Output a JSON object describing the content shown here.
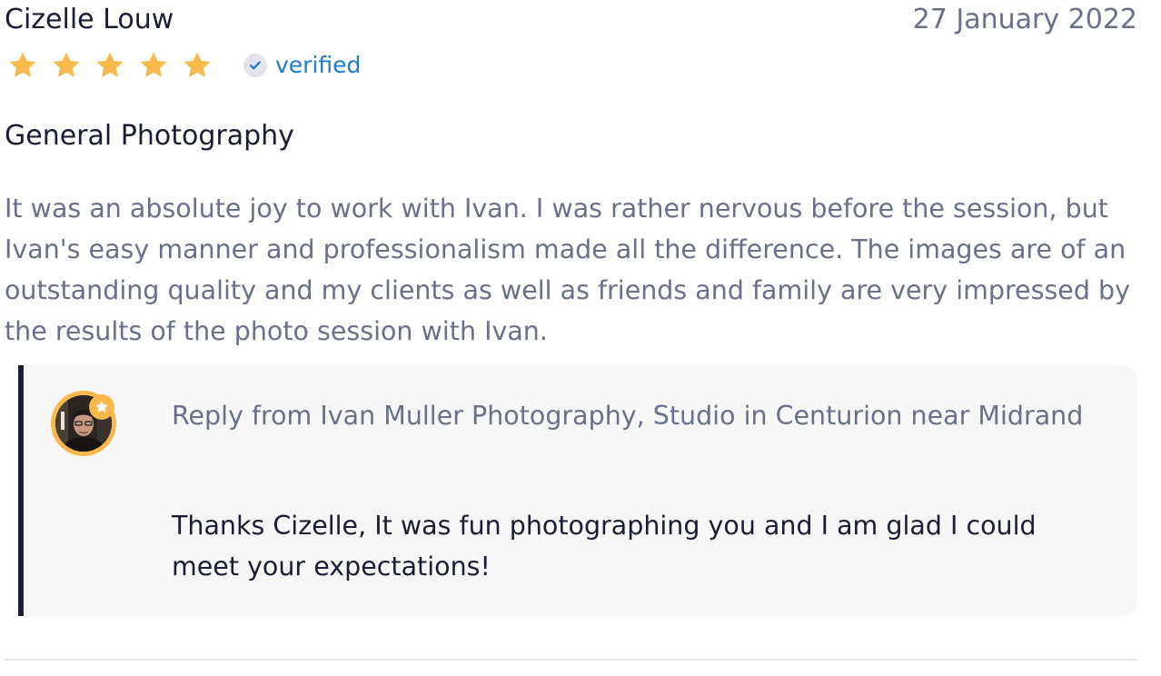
{
  "review": {
    "reviewer_name": "Cizelle Louw",
    "date": "27 January 2022",
    "rating": 5,
    "rating_max": 5,
    "star_color": "#F8B84C",
    "verified_label": "verified",
    "verified_color": "#1B7AD6",
    "title": "General Photography",
    "body": "It was an absolute joy to work with Ivan. I was rather nervous before the session, but Ivan's easy manner and professionalism made all the difference. The images are of an outstanding quality and my clients as well as friends and family are very impressed by the results of the photo session with Ivan."
  },
  "reply": {
    "from": "Reply from Ivan Muller Photography, Studio in Centurion near Midrand",
    "text": "Thanks Cizelle, It was fun photographing you and I am glad I could meet your expectations!",
    "avatar_icon": "photographer-avatar",
    "badge_icon": "star-badge-icon",
    "accent_color": "#1A1D35"
  }
}
